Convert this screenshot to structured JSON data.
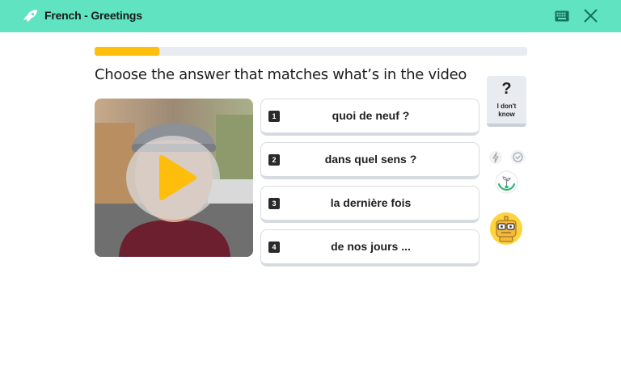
{
  "header": {
    "course_title": "French - Greetings",
    "logo_icon": "rocket-logo-icon",
    "keyboard_icon": "keyboard-icon",
    "close_icon": "close-icon"
  },
  "progress": {
    "fraction": 0.15
  },
  "question": {
    "prompt": "Choose the answer that matches what’s in the video"
  },
  "video": {
    "play_icon": "play-icon"
  },
  "answers": [
    {
      "number": "1",
      "text": "quoi de neuf ?"
    },
    {
      "number": "2",
      "text": "dans quel sens ?"
    },
    {
      "number": "3",
      "text": "la dernière fois"
    },
    {
      "number": "4",
      "text": "de nos jours ..."
    }
  ],
  "side": {
    "dont_know_symbol": "?",
    "dont_know_label_line1": "I don't",
    "dont_know_label_line2": "know",
    "bolt_icon": "bolt-icon",
    "check_icon": "check-circle-icon",
    "plant_icon": "plant-growth-icon",
    "avatar_icon": "robot-avatar-icon"
  },
  "colors": {
    "header_bg": "#5fe3c0",
    "progress_fill": "#ffbe0b",
    "play_button": "#ffbe0b"
  }
}
